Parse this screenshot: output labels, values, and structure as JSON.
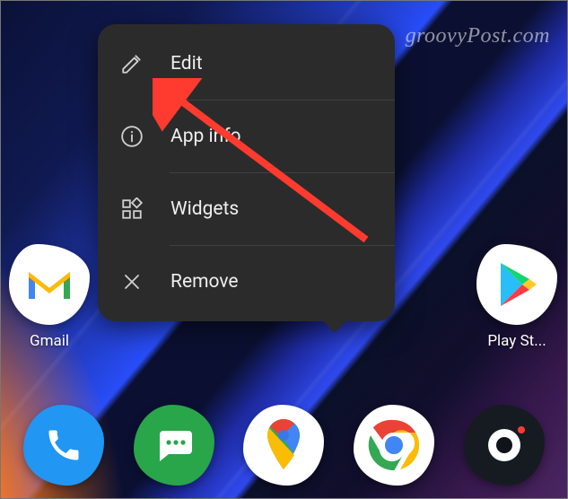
{
  "watermark": "groovyPost.com",
  "menu": {
    "items": [
      {
        "label": "Edit",
        "icon": "pencil-icon"
      },
      {
        "label": "App info",
        "icon": "info-icon"
      },
      {
        "label": "Widgets",
        "icon": "widgets-icon"
      },
      {
        "label": "Remove",
        "icon": "close-icon"
      }
    ]
  },
  "annotation": {
    "target": "Edit"
  },
  "home_apps": [
    {
      "label": "Gmail",
      "icon": "gmail-icon"
    },
    {
      "label": "Play St...",
      "icon": "play-store-icon"
    }
  ],
  "dock_apps": [
    {
      "icon": "phone-icon",
      "color": "#2196f3"
    },
    {
      "icon": "messages-icon",
      "color": "#29a54a"
    },
    {
      "icon": "maps-icon",
      "color": "#ffffff"
    },
    {
      "icon": "chrome-icon",
      "color": "#ffffff"
    },
    {
      "icon": "camera-icon",
      "color": "#12181f"
    }
  ]
}
